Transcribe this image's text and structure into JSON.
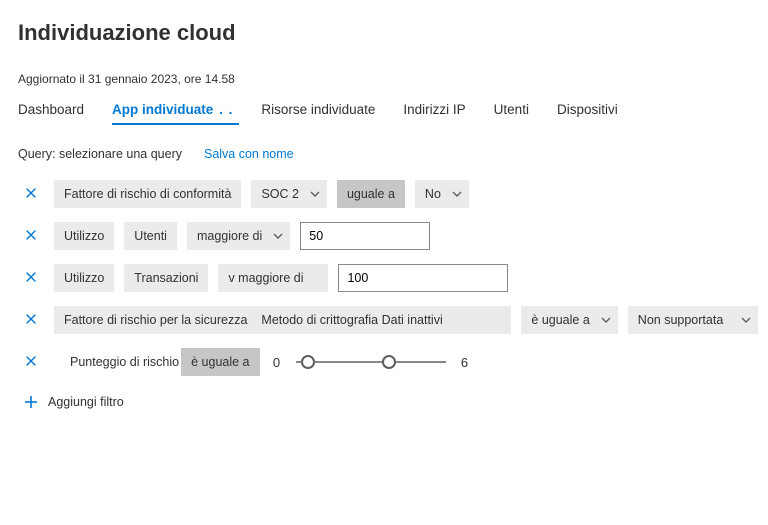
{
  "header": {
    "title": "Individuazione cloud",
    "updated": "Aggiornato il 31 gennaio 2023, ore 14.58"
  },
  "tabs": [
    {
      "label": "Dashboard",
      "active": false
    },
    {
      "label": "App individuate",
      "active": true,
      "dots": ". ."
    },
    {
      "label": "Risorse individuate",
      "active": false
    },
    {
      "label": "Indirizzi IP",
      "active": false
    },
    {
      "label": "Utenti",
      "active": false
    },
    {
      "label": "Dispositivi",
      "active": false
    }
  ],
  "query": {
    "label": "Query: selezionare una query",
    "save_label": "Salva con nome"
  },
  "filters": {
    "row1": {
      "field": "Fattore di rischio di conformità",
      "subfield": "SOC 2",
      "operator": "uguale a",
      "value": "No"
    },
    "row2": {
      "field": "Utilizzo",
      "subfield": "Utenti",
      "operator": "maggiore di",
      "value": "50"
    },
    "row3": {
      "field": "Utilizzo",
      "subfield": "Transazioni",
      "operator": "v maggiore di",
      "value": "100"
    },
    "row4": {
      "field": "Fattore di rischio per la sicurezza",
      "subfield": "Metodo di crittografia Dati inattivi",
      "operator": "è uguale a",
      "value": "Non supportata"
    },
    "row5": {
      "field": "Punteggio di rischio",
      "operator": "è uguale a",
      "min": "0",
      "max": "6"
    }
  },
  "add_filter_label": "Aggiungi filtro"
}
